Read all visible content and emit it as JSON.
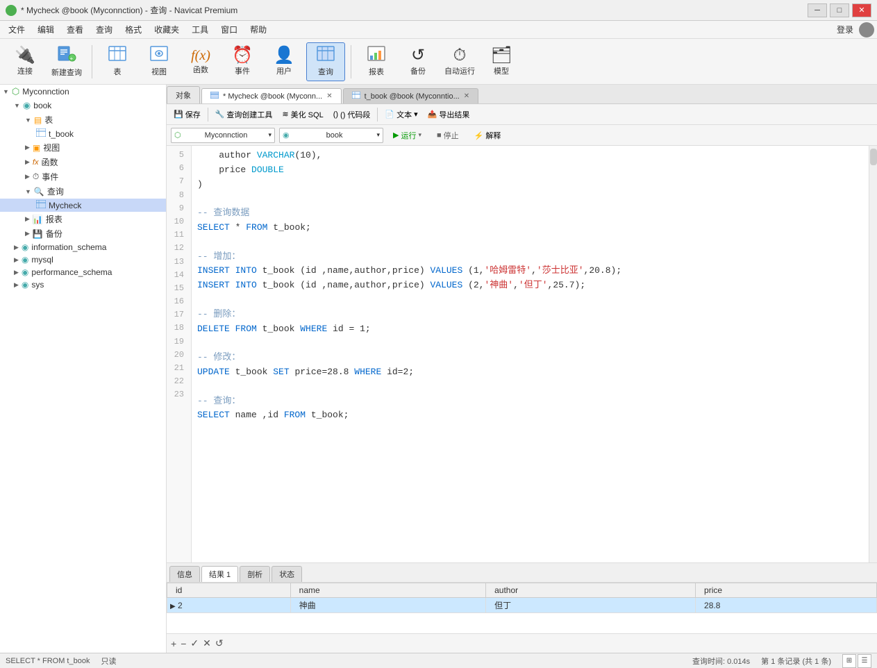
{
  "titlebar": {
    "icon": "●",
    "title": "* Mycheck @book (Myconnction) - 查询 - Navicat Premium",
    "min_btn": "─",
    "max_btn": "□",
    "close_btn": "✕"
  },
  "menubar": {
    "items": [
      "文件",
      "编辑",
      "查看",
      "查询",
      "格式",
      "收藏夹",
      "工具",
      "窗口",
      "帮助"
    ],
    "login": "登录"
  },
  "toolbar": {
    "buttons": [
      {
        "icon": "🔌",
        "label": "连接"
      },
      {
        "icon": "⊞",
        "label": "新建查询"
      },
      {
        "icon": "⊞",
        "label": "表"
      },
      {
        "icon": "◫",
        "label": "视图"
      },
      {
        "icon": "ƒ(x)",
        "label": "函数"
      },
      {
        "icon": "⏰",
        "label": "事件"
      },
      {
        "icon": "👤",
        "label": "用户"
      },
      {
        "icon": "📊",
        "label": "查询"
      },
      {
        "icon": "📈",
        "label": "报表"
      },
      {
        "icon": "↺",
        "label": "备份"
      },
      {
        "icon": "⏱",
        "label": "自动运行"
      },
      {
        "icon": "🗂",
        "label": "模型"
      }
    ]
  },
  "sidebar": {
    "items": [
      {
        "level": 0,
        "label": "Myconnction",
        "icon": "conn",
        "expanded": true
      },
      {
        "level": 1,
        "label": "book",
        "icon": "db",
        "expanded": true
      },
      {
        "level": 2,
        "label": "表",
        "icon": "folder",
        "expanded": true
      },
      {
        "level": 3,
        "label": "t_book",
        "icon": "table"
      },
      {
        "level": 2,
        "label": "视图",
        "icon": "folder"
      },
      {
        "level": 2,
        "label": "函数",
        "icon": "folder"
      },
      {
        "level": 2,
        "label": "事件",
        "icon": "folder"
      },
      {
        "level": 2,
        "label": "查询",
        "icon": "folder",
        "expanded": true
      },
      {
        "level": 3,
        "label": "Mycheck",
        "icon": "query",
        "selected": true
      },
      {
        "level": 2,
        "label": "报表",
        "icon": "folder"
      },
      {
        "level": 2,
        "label": "备份",
        "icon": "folder"
      },
      {
        "level": 1,
        "label": "information_schema",
        "icon": "db"
      },
      {
        "level": 1,
        "label": "mysql",
        "icon": "db"
      },
      {
        "level": 1,
        "label": "performance_schema",
        "icon": "db"
      },
      {
        "level": 1,
        "label": "sys",
        "icon": "db"
      }
    ]
  },
  "tabs": {
    "items": [
      {
        "label": "对象",
        "active": false,
        "type": "obj"
      },
      {
        "label": "* Mycheck @book (Myconn...",
        "active": true,
        "type": "query",
        "closable": true
      },
      {
        "label": "t_book @book (Myconntio...",
        "active": false,
        "type": "table",
        "closable": true
      }
    ]
  },
  "query_toolbar": {
    "save": "保存",
    "build": "查询创建工具",
    "beautify": "美化 SQL",
    "snippet": "() 代码段",
    "text": "文本",
    "export": "导出结果"
  },
  "selectors": {
    "connection": "Myconnction",
    "database": "book",
    "run": "▶ 运行",
    "stop": "■ 停止",
    "explain": "解释"
  },
  "code": {
    "lines": [
      {
        "num": 5,
        "content": "    author VARCHAR(10),"
      },
      {
        "num": 6,
        "content": "    price DOUBLE"
      },
      {
        "num": 7,
        "content": ")"
      },
      {
        "num": 8,
        "content": ""
      },
      {
        "num": 9,
        "content": "-- 查询数据"
      },
      {
        "num": 10,
        "content": "SELECT * FROM t_book;"
      },
      {
        "num": 11,
        "content": ""
      },
      {
        "num": 12,
        "content": "-- 增加："
      },
      {
        "num": 13,
        "content": "INSERT INTO t_book (id ,name,author,price) VALUES (1,'哈姆雷特','莎士比亚',20.8);"
      },
      {
        "num": 14,
        "content": "INSERT INTO t_book (id ,name,author,price) VALUES (2,'神曲','但丁',25.7);"
      },
      {
        "num": 15,
        "content": ""
      },
      {
        "num": 16,
        "content": "-- 删除："
      },
      {
        "num": 17,
        "content": "DELETE FROM t_book WHERE id = 1;"
      },
      {
        "num": 18,
        "content": ""
      },
      {
        "num": 19,
        "content": "-- 修改："
      },
      {
        "num": 20,
        "content": "UPDATE t_book SET price=28.8 WHERE id=2;"
      },
      {
        "num": 21,
        "content": ""
      },
      {
        "num": 22,
        "content": "-- 查询："
      },
      {
        "num": 23,
        "content": "SELECT name ,id FROM t_book;"
      }
    ]
  },
  "result_tabs": [
    "信息",
    "结果 1",
    "剖析",
    "状态"
  ],
  "result_active_tab": "结果 1",
  "result_table": {
    "columns": [
      "id",
      "name",
      "author",
      "price"
    ],
    "rows": [
      {
        "id": "2",
        "name": "神曲",
        "author": "但丁",
        "price": "28.8",
        "selected": true
      }
    ]
  },
  "bottom_toolbar": {
    "add": "+",
    "remove": "−",
    "confirm": "✓",
    "cancel": "✕",
    "refresh": "↺"
  },
  "status_bar": {
    "query": "SELECT * FROM t_book",
    "readonly": "只读",
    "time": "查询时间: 0.014s",
    "records": "第 1 条记录 (共 1 条)"
  }
}
